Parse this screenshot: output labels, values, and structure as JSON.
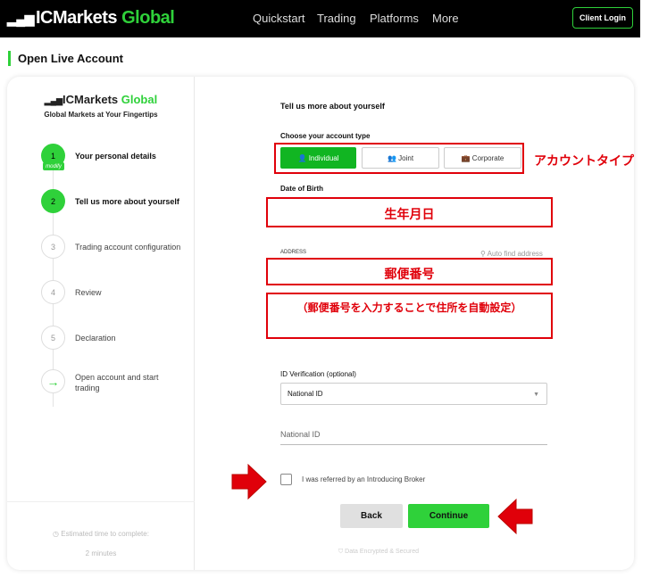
{
  "header": {
    "logo_ic": "IC",
    "logo_markets": "Markets",
    "logo_global": "Global",
    "nav": [
      "Quickstart",
      "Trading",
      "Platforms",
      "More"
    ],
    "client_login": "Client Login"
  },
  "page": {
    "title": "Open Live Account"
  },
  "sidebar": {
    "logo_ic": "IC",
    "logo_markets": "Markets",
    "logo_global": "Global",
    "tagline": "Global Markets at Your Fingertips",
    "modify": "modify",
    "steps": [
      {
        "num": "1",
        "label": "Your personal details"
      },
      {
        "num": "2",
        "label": "Tell us more about yourself"
      },
      {
        "num": "3",
        "label": "Trading account configuration"
      },
      {
        "num": "4",
        "label": "Review"
      },
      {
        "num": "5",
        "label": "Declaration"
      },
      {
        "num": "→",
        "label1": "Open account and start",
        "label2": "trading"
      }
    ],
    "estimated": "Estimated time to complete:",
    "minutes": "2 minutes"
  },
  "form": {
    "title": "Tell us more about yourself",
    "account_type_label": "Choose your account type",
    "account_types": [
      "Individual",
      "Joint",
      "Corporate"
    ],
    "dob_label": "Date of Birth",
    "address_label": "ADDRESS",
    "auto_find": "Auto find address",
    "id_label": "ID Verification (optional)",
    "id_selected": "National ID",
    "national_id_placeholder": "National ID",
    "broker_checkbox": "I was referred by an Introducing Broker",
    "back": "Back",
    "continue": "Continue",
    "secure": "Data Encrypted & Secured"
  },
  "annotations": {
    "account_type": "アカウントタイプ",
    "dob": "生年月日",
    "postal": "郵便番号",
    "postal_note": "（郵便番号を入力することで住所を自動設定）"
  },
  "colors": {
    "brand_green": "#2fd13a",
    "annotation_red": "#e0000a"
  }
}
